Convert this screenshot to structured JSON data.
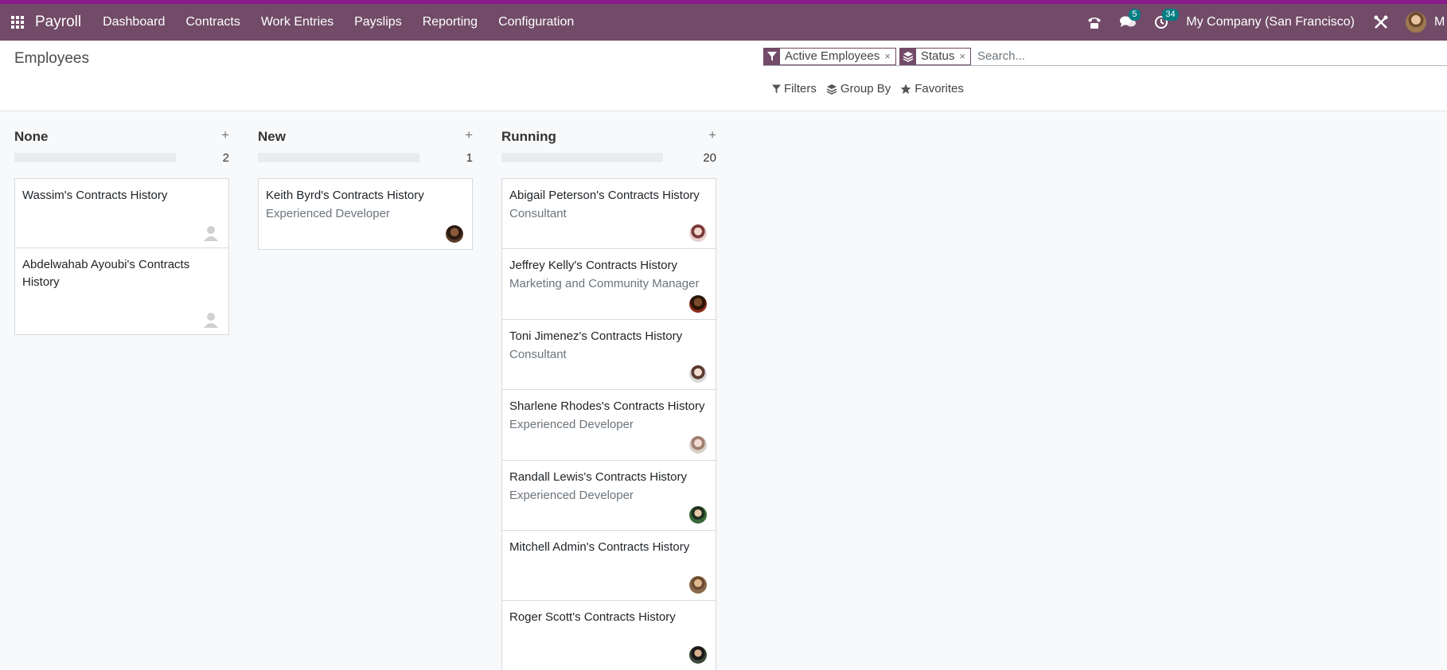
{
  "navbar": {
    "app_name": "Payroll",
    "menu": [
      "Dashboard",
      "Contracts",
      "Work Entries",
      "Payslips",
      "Reporting",
      "Configuration"
    ],
    "messages_count": "5",
    "activities_count": "34",
    "company": "My Company (San Francisco)",
    "user_initial": "M"
  },
  "control_panel": {
    "breadcrumb": "Employees",
    "facets": [
      {
        "icon": "filter-icon",
        "value": "Active Employees"
      },
      {
        "icon": "group-by-icon",
        "value": "Status"
      }
    ],
    "search_placeholder": "Search...",
    "tools": {
      "filters": "Filters",
      "group_by": "Group By",
      "favorites": "Favorites"
    }
  },
  "columns": [
    {
      "title": "None",
      "count": "2",
      "cards": [
        {
          "title": "Wassim's Contracts History",
          "subtitle": "",
          "avatar": "placeholder"
        },
        {
          "title": "Abdelwahab Ayoubi's Contracts History",
          "subtitle": "",
          "avatar": "placeholder"
        }
      ]
    },
    {
      "title": "New",
      "count": "1",
      "cards": [
        {
          "title": "Keith Byrd's Contracts History",
          "subtitle": "Experienced Developer",
          "avatar": "photo"
        }
      ]
    },
    {
      "title": "Running",
      "count": "20",
      "cards": [
        {
          "title": "Abigail Peterson's Contracts History",
          "subtitle": "Consultant",
          "avatar": "photo"
        },
        {
          "title": "Jeffrey Kelly's Contracts History",
          "subtitle": "Marketing and Community Manager",
          "avatar": "photo"
        },
        {
          "title": "Toni Jimenez's Contracts History",
          "subtitle": "Consultant",
          "avatar": "photo"
        },
        {
          "title": "Sharlene Rhodes's Contracts History",
          "subtitle": "Experienced Developer",
          "avatar": "photo"
        },
        {
          "title": "Randall Lewis's Contracts History",
          "subtitle": "Experienced Developer",
          "avatar": "photo"
        },
        {
          "title": "Mitchell Admin's Contracts History",
          "subtitle": "",
          "avatar": "photo"
        },
        {
          "title": "Roger Scott's Contracts History",
          "subtitle": "",
          "avatar": "photo"
        }
      ]
    }
  ],
  "colors": {
    "navbar": "#714b67",
    "topline": "#8b1a8b",
    "badge": "#017e84"
  }
}
